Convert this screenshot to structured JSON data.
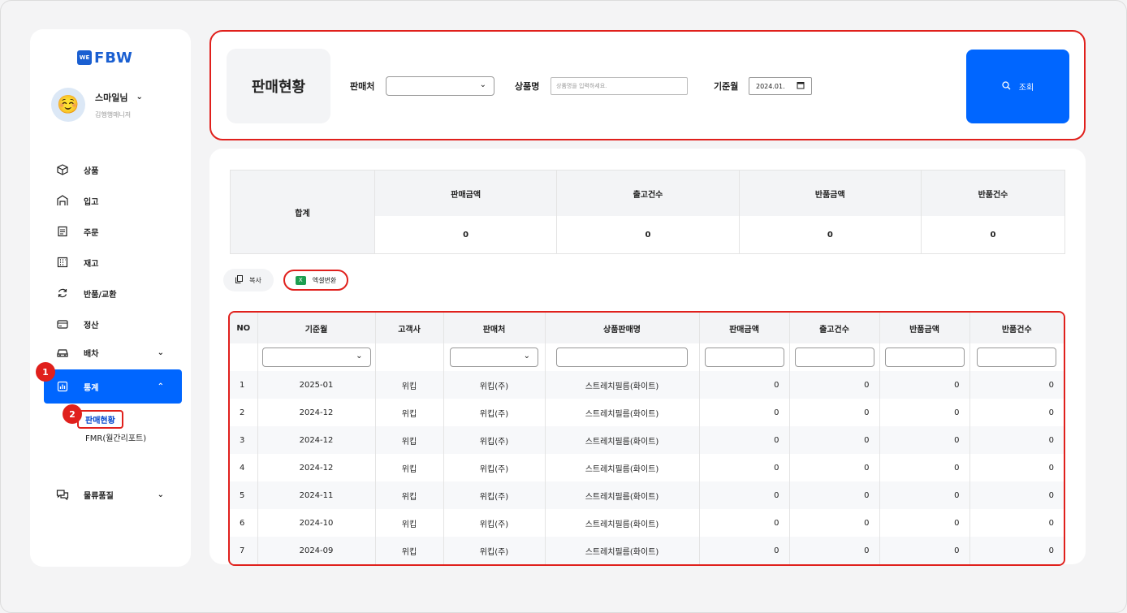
{
  "sidebar": {
    "logo_box": "WE",
    "logo_text": "FBW",
    "profile": {
      "emoji": "☺️",
      "name": "스마일님",
      "role": "김행행매니저"
    },
    "items": [
      {
        "label": "상품",
        "icon": "box-icon"
      },
      {
        "label": "입고",
        "icon": "warehouse-icon"
      },
      {
        "label": "주문",
        "icon": "receipt-icon"
      },
      {
        "label": "재고",
        "icon": "grid-icon"
      },
      {
        "label": "반품/교환",
        "icon": "refresh-icon"
      },
      {
        "label": "정산",
        "icon": "card-icon"
      },
      {
        "label": "배차",
        "icon": "car-icon"
      },
      {
        "label": "통계",
        "icon": "chart-icon"
      },
      {
        "label": "물류품질",
        "icon": "chat-icon"
      }
    ],
    "sub_items": [
      "판매현황",
      "FMR(월간리포트)"
    ],
    "badges": [
      "1",
      "2"
    ]
  },
  "search": {
    "page_title": "판매현황",
    "seller_label": "판매처",
    "product_label": "상품명",
    "product_placeholder": "상품명을 입력하세요.",
    "month_label": "기준월",
    "month_value": "2024.01.",
    "search_button": "조회"
  },
  "summary": {
    "label": "합계",
    "columns": [
      {
        "head": "판매금액",
        "value": "0"
      },
      {
        "head": "출고건수",
        "value": "0"
      },
      {
        "head": "반품금액",
        "value": "0"
      },
      {
        "head": "반품건수",
        "value": "0"
      }
    ]
  },
  "actions": {
    "copy": "복사",
    "excel": "엑셀변환"
  },
  "table": {
    "headers": [
      "NO",
      "기준월",
      "고객사",
      "판매처",
      "상품판매명",
      "판매금액",
      "출고건수",
      "반품금액",
      "반품건수"
    ],
    "rows": [
      [
        "1",
        "2025-01",
        "위킵",
        "위킵(주)",
        "스트레치필름(화이트)",
        "0",
        "0",
        "0",
        "0"
      ],
      [
        "2",
        "2024-12",
        "위킵",
        "위킵(주)",
        "스트레치필름(화이트)",
        "0",
        "0",
        "0",
        "0"
      ],
      [
        "3",
        "2024-12",
        "위킵",
        "위킵(주)",
        "스트레치필름(화이트)",
        "0",
        "0",
        "0",
        "0"
      ],
      [
        "4",
        "2024-12",
        "위킵",
        "위킵(주)",
        "스트레치필름(화이트)",
        "0",
        "0",
        "0",
        "0"
      ],
      [
        "5",
        "2024-11",
        "위킵",
        "위킵(주)",
        "스트레치필름(화이트)",
        "0",
        "0",
        "0",
        "0"
      ],
      [
        "6",
        "2024-10",
        "위킵",
        "위킵(주)",
        "스트레치필름(화이트)",
        "0",
        "0",
        "0",
        "0"
      ],
      [
        "7",
        "2024-09",
        "위킵",
        "위킵(주)",
        "스트레치필름(화이트)",
        "0",
        "0",
        "0",
        "0"
      ]
    ]
  },
  "colors": {
    "accent": "#0066ff",
    "highlight": "#e0201c"
  }
}
